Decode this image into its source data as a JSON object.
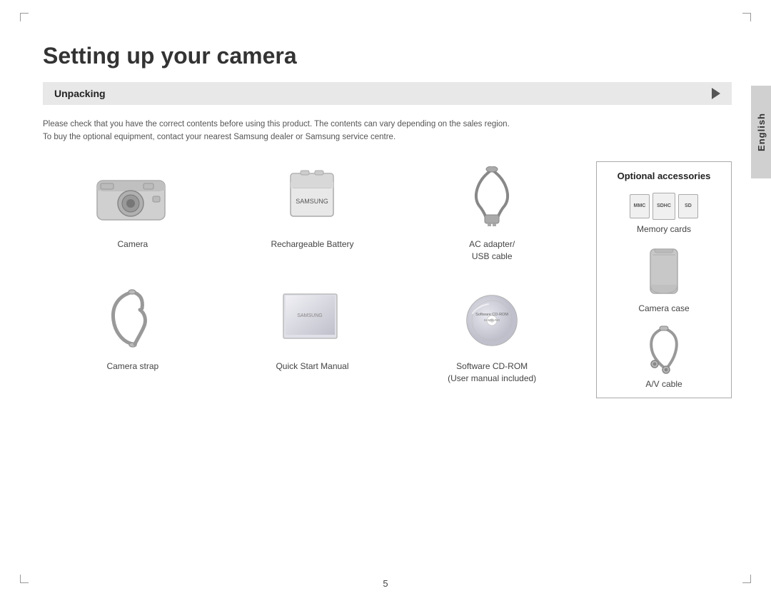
{
  "page": {
    "title": "Setting up your camera",
    "section": "Unpacking",
    "description_line1": "Please check that you have the correct contents before using this product. The contents can vary depending on the sales region.",
    "description_line2": "To buy the optional equipment, contact your nearest Samsung dealer or Samsung service centre.",
    "page_number": "5",
    "language_tab": "English"
  },
  "items": [
    {
      "label": "Camera",
      "id": "camera"
    },
    {
      "label": "Rechargeable Battery",
      "id": "battery"
    },
    {
      "label": "AC adapter/\nUSB cable",
      "id": "ac-adapter"
    },
    {
      "label": "Camera strap",
      "id": "strap"
    },
    {
      "label": "Quick Start Manual",
      "id": "manual"
    },
    {
      "label": "Software CD-ROM\n(User manual included)",
      "id": "cdrom"
    }
  ],
  "optional": {
    "title": "Optional accessories",
    "items": [
      {
        "label": "Memory cards",
        "id": "memory-cards"
      },
      {
        "label": "Camera case",
        "id": "camera-case"
      },
      {
        "label": "A/V cable",
        "id": "av-cable"
      }
    ]
  }
}
